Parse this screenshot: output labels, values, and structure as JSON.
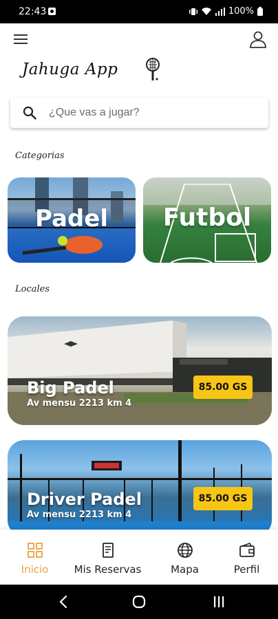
{
  "status_bar": {
    "time": "22:43",
    "battery": "100%",
    "icons": [
      "gallery-icon",
      "vibrate-icon",
      "wifi-icon",
      "signal-icon",
      "battery-icon"
    ]
  },
  "app_bar": {
    "brand": "Jahuga App",
    "icons": [
      "menu-icon",
      "user-icon",
      "padel-racket-icon"
    ]
  },
  "search": {
    "placeholder": "¿Que vas a jugar?",
    "value": ""
  },
  "categories": {
    "label": "Categorias",
    "items": [
      {
        "title": "Padel"
      },
      {
        "title": "Futbol"
      }
    ]
  },
  "locales": {
    "label": "Locales",
    "items": [
      {
        "name": "Big Padel",
        "address": "Av mensu 2213 km 4",
        "price": "85.00 GS"
      },
      {
        "name": "Driver Padel",
        "address": "Av mensu 2213 km 4",
        "price": "85.00 GS"
      }
    ]
  },
  "bottom_nav": {
    "items": [
      {
        "label": "Inicio",
        "icon": "grid-icon",
        "active": true
      },
      {
        "label": "Mis Reservas",
        "icon": "document-icon",
        "active": false
      },
      {
        "label": "Mapa",
        "icon": "globe-icon",
        "active": false
      },
      {
        "label": "Perfil",
        "icon": "wallet-icon",
        "active": false
      }
    ]
  },
  "colors": {
    "accent": "#e8a23a",
    "price_badge": "#f7c514"
  }
}
